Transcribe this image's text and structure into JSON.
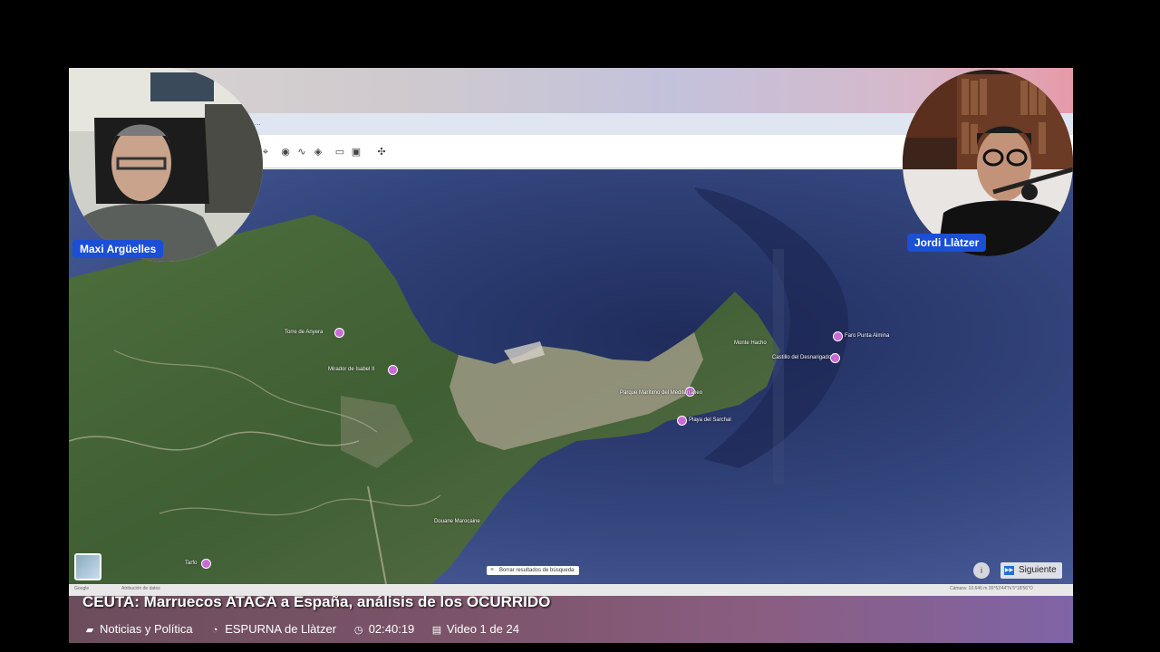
{
  "browser": {
    "url_fragment": "..."
  },
  "map": {
    "places": [
      {
        "name": "Faro Punta Almina"
      },
      {
        "name": "Torre de Anyera"
      },
      {
        "name": "Mirador de Isabel II"
      },
      {
        "name": "Douane Marocaine"
      },
      {
        "name": "Tarfo"
      },
      {
        "name": "Castillo del Desnarigado"
      },
      {
        "name": "Monte Hacho"
      },
      {
        "name": "Parque Marítimo del Mediterráneo"
      },
      {
        "name": "Playa del Sarchal"
      }
    ],
    "clear_search_label": "Borrar resultados de búsqueda",
    "status_left": "Google",
    "status_mid": "Atribución de datos",
    "status_right": "Cámara: 10.646 m   35°53'44\"N 5°18'56\"O"
  },
  "overlay": {
    "next_label": "Siguiente"
  },
  "video": {
    "title": "CEUTA: Marruecos ATACA a España, análisis de los OCURRIDO",
    "category": "Noticias y Política",
    "channel": "ESPURNA de Llàtzer",
    "duration": "02:40:19",
    "position": "Video 1 de 24"
  },
  "participants": {
    "left": "Maxi Argüelles",
    "right": "Jordi Llàtzer"
  },
  "colors": {
    "nameplate": "#1a4fd6",
    "sea": "#2b3a6b",
    "land": "#4a6b3c",
    "poi": "#c96ad6"
  },
  "icons": {
    "category": "folder-icon",
    "channel": "user-icon",
    "duration": "clock-icon",
    "position": "playlist-icon"
  }
}
